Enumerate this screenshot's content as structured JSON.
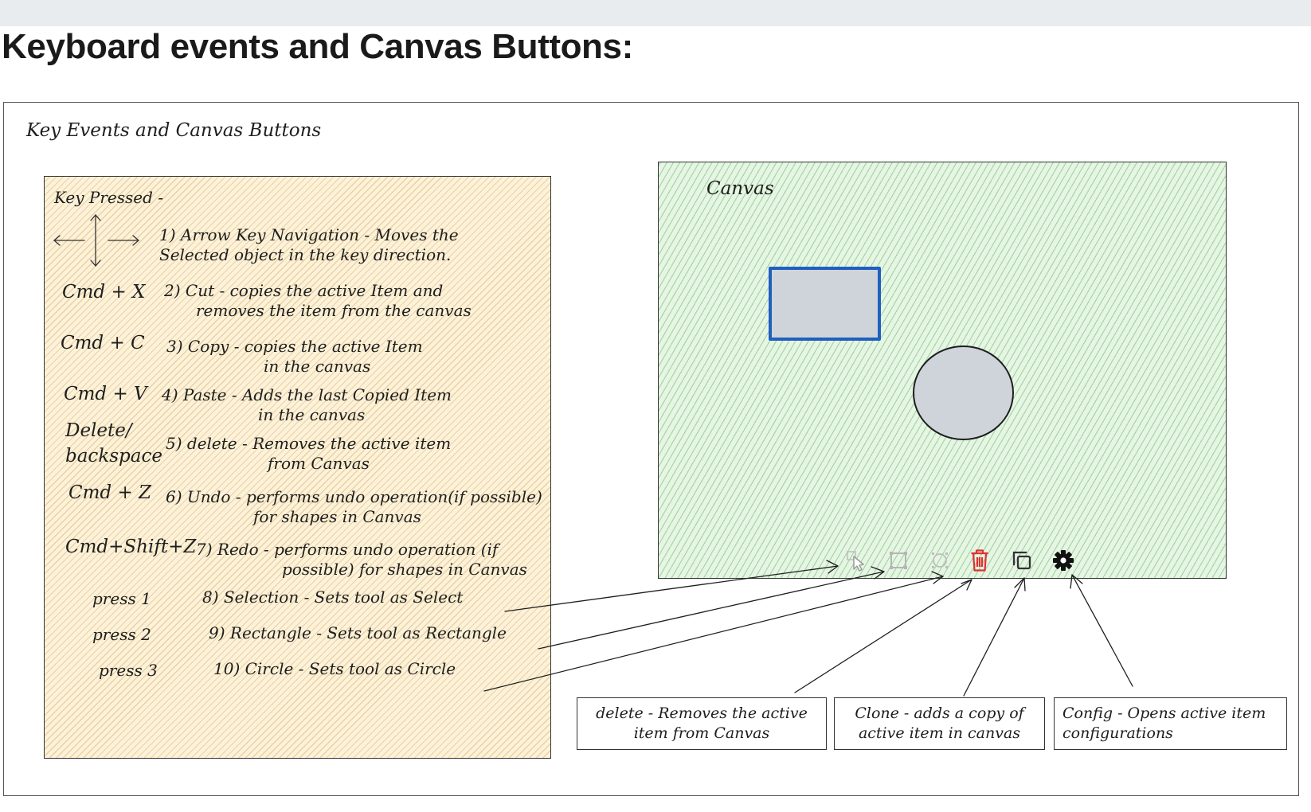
{
  "page_title": "Keyboard events and Canvas Buttons:",
  "diagram": {
    "frame_title": "Key Events and Canvas Buttons",
    "key_panel": {
      "heading": "Key Pressed -",
      "arrow_keys_desc": [
        "1) Arrow Key Navigation - Moves the",
        "Selected object in  the key direction."
      ],
      "entries": [
        {
          "key": "Cmd + X",
          "lines": [
            "2) Cut - copies the active Item and",
            "removes the item from the canvas"
          ]
        },
        {
          "key": "Cmd + C",
          "lines": [
            "3) Copy - copies the active Item",
            "in the canvas"
          ]
        },
        {
          "key": "Cmd + V",
          "lines": [
            "4) Paste - Adds the last Copied Item",
            "in the canvas"
          ]
        },
        {
          "key_lines": [
            "Delete/",
            "backspace"
          ],
          "lines": [
            "5) delete - Removes the active item",
            "from Canvas"
          ]
        },
        {
          "key": "Cmd + Z",
          "lines": [
            "6) Undo - performs undo operation(if possible)",
            "for shapes in Canvas"
          ]
        },
        {
          "key": "Cmd+Shift+Z",
          "lines": [
            "7) Redo - performs undo operation (if",
            "possible) for shapes in Canvas"
          ]
        },
        {
          "key": "press 1",
          "lines": [
            "8) Selection - Sets tool as Select"
          ]
        },
        {
          "key": "press 2",
          "lines": [
            "9) Rectangle - Sets tool as Rectangle"
          ]
        },
        {
          "key": "press 3",
          "lines": [
            "10) Circle - Sets tool as Circle"
          ]
        }
      ]
    },
    "canvas": {
      "label": "Canvas",
      "toolbar": [
        {
          "icon": "select-pointer-icon",
          "color": "#c8c8c8"
        },
        {
          "icon": "rectangle-icon",
          "color": "#c8c8c8"
        },
        {
          "icon": "circle-icon",
          "color": "#c8c8c8"
        },
        {
          "icon": "trash-icon",
          "color": "#e03131"
        },
        {
          "icon": "clone-icon",
          "color": "#333333"
        },
        {
          "icon": "gear-icon",
          "color": "#111111"
        }
      ]
    },
    "callouts": {
      "delete": [
        "delete - Removes the active",
        "item from Canvas"
      ],
      "clone": [
        "Clone - adds a copy of",
        "active item in canvas"
      ],
      "config": [
        "Config - Opens active item",
        "configurations"
      ]
    }
  }
}
